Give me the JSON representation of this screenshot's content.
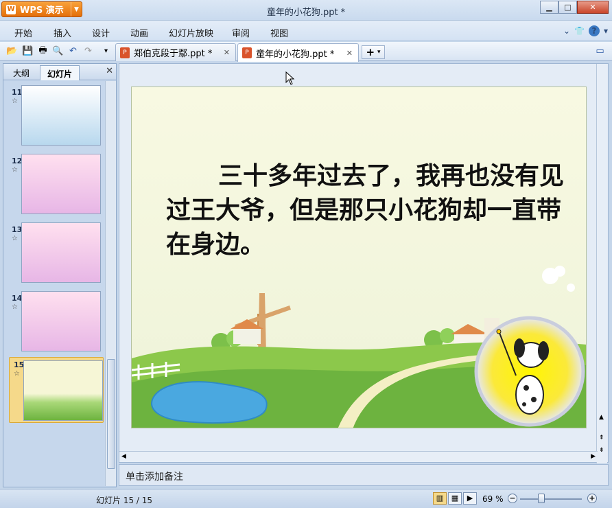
{
  "window": {
    "app_button": "WPS 演示",
    "title": "童年的小花狗.ppt *"
  },
  "menu": {
    "items": [
      "开始",
      "插入",
      "设计",
      "动画",
      "幻灯片放映",
      "审阅",
      "视图"
    ]
  },
  "tabs": [
    {
      "label": "郑伯克段于鄢.ppt *",
      "active": false
    },
    {
      "label": "童年的小花狗.ppt *",
      "active": true
    }
  ],
  "left_panel": {
    "tab_outline": "大纲",
    "tab_slides": "幻灯片",
    "thumbnails": [
      {
        "number": "11",
        "bg": "#b8d8ee"
      },
      {
        "number": "12",
        "bg": "#f7c2de"
      },
      {
        "number": "13",
        "bg": "#f7c2de"
      },
      {
        "number": "14",
        "bg": "#f7c2de"
      },
      {
        "number": "15",
        "bg": "#f6f6d6",
        "active": true
      }
    ]
  },
  "slide": {
    "text": "三十多年过去了，我再也没有见过王大爷，但是那只小花狗却一直带在身边。"
  },
  "notes": {
    "placeholder": "单击添加备注"
  },
  "status": {
    "slide_counter": "幻灯片 15 / 15",
    "zoom": "69 %"
  },
  "colors": {
    "accent": "#e46f0a",
    "highlight": "#f5d98a"
  }
}
